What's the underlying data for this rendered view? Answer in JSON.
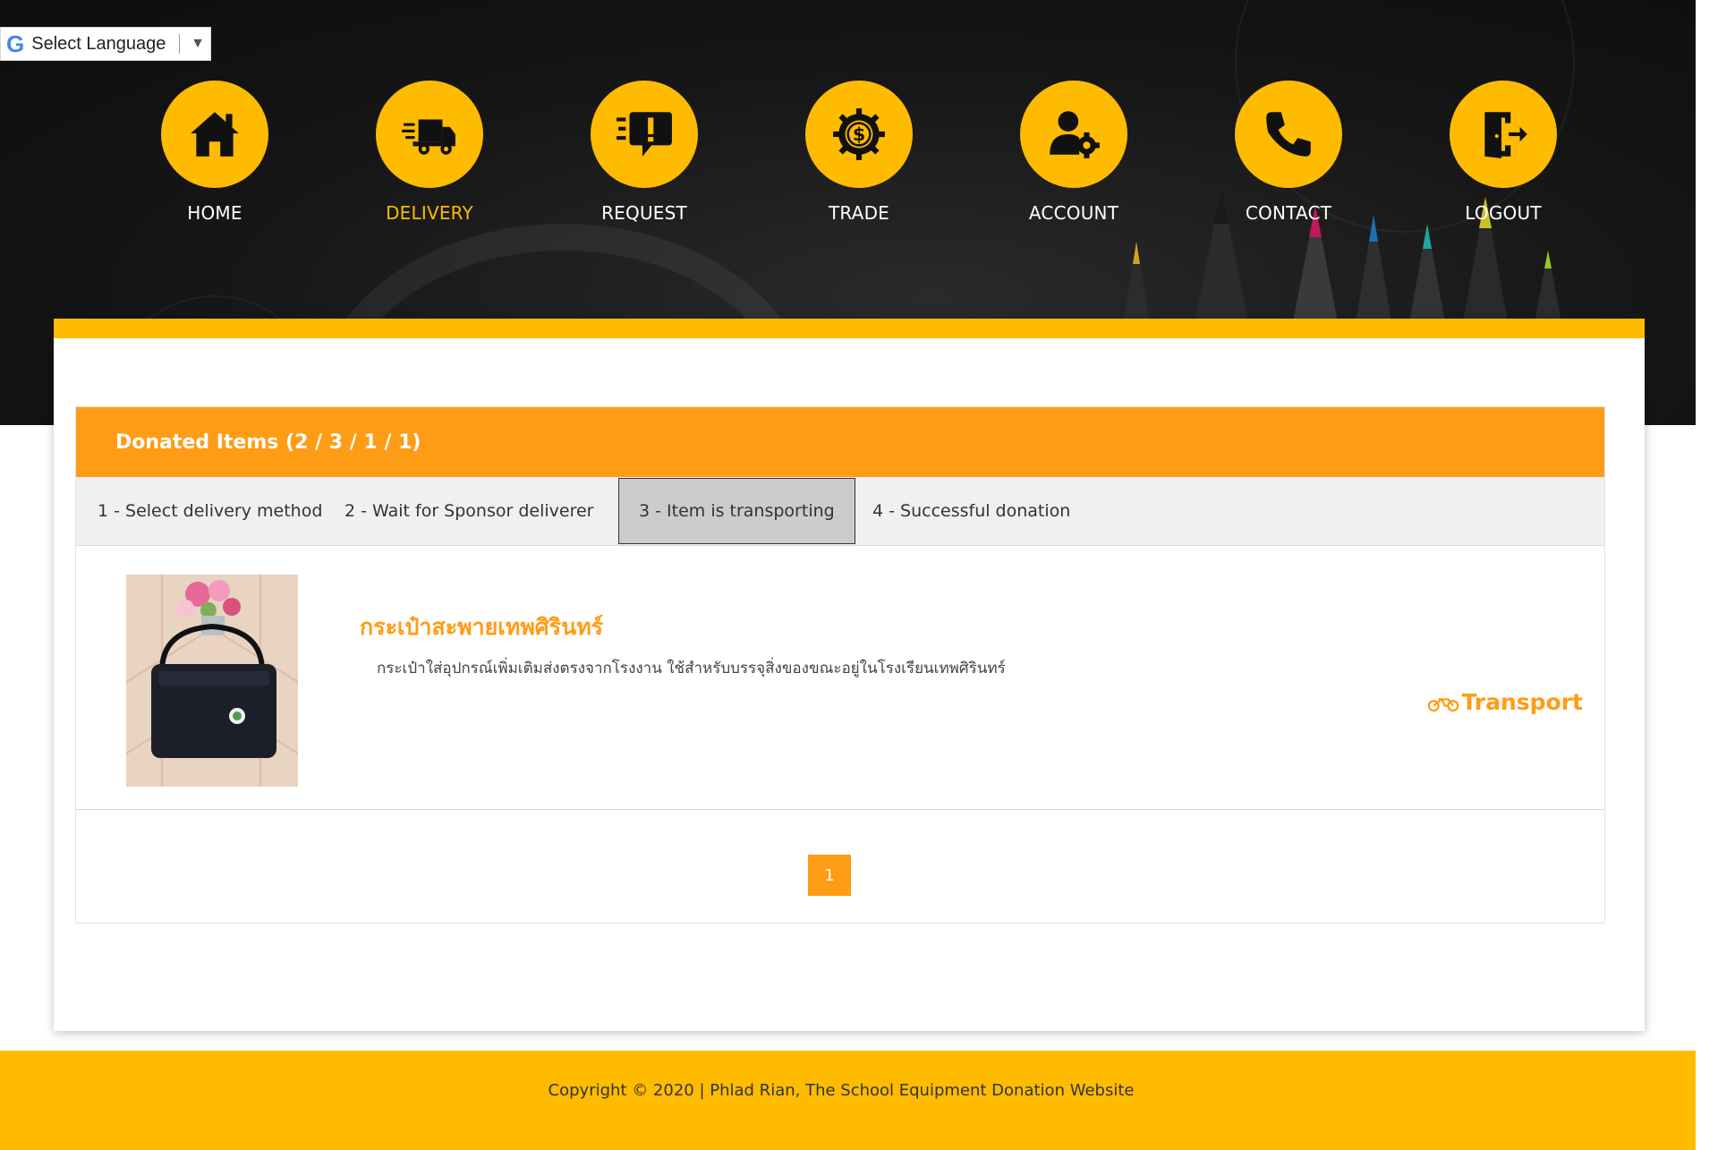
{
  "language_widget": {
    "label": "Select Language",
    "logo": "G",
    "arrow": "▼"
  },
  "nav": {
    "items": [
      {
        "label": "HOME",
        "icon": "home-icon",
        "active": false
      },
      {
        "label": "DELIVERY",
        "icon": "delivery-truck-icon",
        "active": true
      },
      {
        "label": "REQUEST",
        "icon": "request-alert-icon",
        "active": false
      },
      {
        "label": "TRADE",
        "icon": "dollar-gear-icon",
        "active": false
      },
      {
        "label": "ACCOUNT",
        "icon": "user-settings-icon",
        "active": false
      },
      {
        "label": "CONTACT",
        "icon": "phone-icon",
        "active": false
      },
      {
        "label": "LOGOUT",
        "icon": "logout-door-icon",
        "active": false
      }
    ]
  },
  "panel": {
    "title": "Donated Items (2 / 3 / 1 / 1)",
    "tabs": [
      {
        "label": "1 - Select delivery method",
        "active": false
      },
      {
        "label": "2 - Wait for Sponsor deliverer",
        "active": false
      },
      {
        "label": "3 - Item is transporting",
        "active": true
      },
      {
        "label": "4 - Successful donation",
        "active": false
      }
    ],
    "items": [
      {
        "title": "กระเป๋าสะพายเทพศิรินทร์",
        "description": "กระเป๋าใส่อุปกรณ์เพิ่มเติมส่งตรงจากโรงงาน ใช้สำหรับบรรจุสิ่งของขณะอยู่ในโรงเรียนเทพศิรินทร์",
        "action_label": "Transport",
        "action_icon": "motorcycle-icon"
      }
    ],
    "pagination": {
      "current": "1"
    }
  },
  "footer": {
    "text": "Copyright © 2020 | Phlad Rian, The School Equipment Donation Website"
  },
  "colors": {
    "accent_yellow": "#ffbb00",
    "accent_orange": "#ff9c15",
    "header_dark": "#161616"
  }
}
